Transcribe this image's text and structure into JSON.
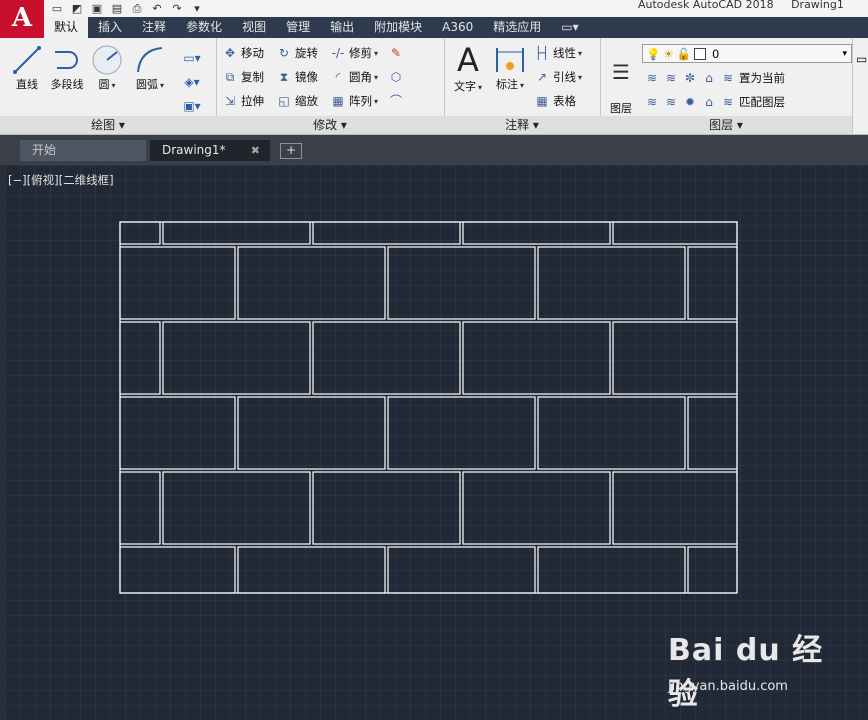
{
  "app": {
    "logo_letter": "A",
    "title": "Autodesk AutoCAD 2018",
    "document_title": "Drawing1"
  },
  "ribbon_tabs": [
    "默认",
    "插入",
    "注释",
    "参数化",
    "视图",
    "管理",
    "输出",
    "附加模块",
    "A360",
    "精选应用",
    ""
  ],
  "draw_panel": {
    "title": "绘图",
    "tools": [
      "直线",
      "多段线",
      "圆",
      "圆弧"
    ]
  },
  "modify_panel": {
    "title": "修改",
    "rows": [
      [
        "移动",
        "旋转",
        "修剪"
      ],
      [
        "复制",
        "镜像",
        "圆角"
      ],
      [
        "拉伸",
        "缩放",
        "阵列"
      ]
    ]
  },
  "annotation_panel": {
    "title": "注释",
    "text_tool": "文字",
    "dim_tool": "标注",
    "rows": [
      "线性",
      "引线",
      "表格"
    ]
  },
  "layers_panel": {
    "title": "图层",
    "props_tool": "图层\n特性",
    "current_layer": "0",
    "actions": [
      "置为当前",
      "匹配图层"
    ]
  },
  "doc_tabs": {
    "start": "开始",
    "drawing": "Drawing1*"
  },
  "viewport_label": "[−][俯视][二维线框]",
  "watermark": {
    "brand": "Bai du 经验",
    "url": "jingyan.baidu.com"
  },
  "colors": {
    "canvas": "#222936",
    "lines": "#ffffff",
    "logo": "#c8102e",
    "ribbon": "#f0f0f0"
  }
}
